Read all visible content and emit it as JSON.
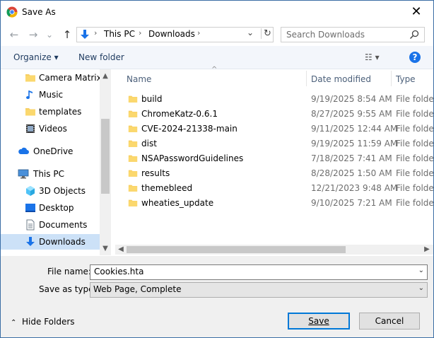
{
  "window": {
    "title": "Save As",
    "close_glyph": "✕"
  },
  "nav": {
    "back_glyph": "←",
    "forward_glyph": "→",
    "recent_glyph": "⌄",
    "up_glyph": "↑",
    "breadcrumbs": [
      "This PC",
      "Downloads"
    ],
    "breadcrumb_sep": "›",
    "dropdown_glyph": "⌄",
    "refresh_glyph": "↻",
    "search_placeholder": "Search Downloads"
  },
  "toolbar": {
    "organize_label": "Organize ▾",
    "new_folder_label": "New folder",
    "view_glyph": "☷ ▾",
    "help_glyph": "?"
  },
  "sidebar": {
    "items": [
      {
        "label": "Camera Matrix",
        "icon": "folder-icon"
      },
      {
        "label": "Music",
        "icon": "music-icon"
      },
      {
        "label": "templates",
        "icon": "folder-icon"
      },
      {
        "label": "Videos",
        "icon": "film-icon"
      },
      {
        "label": "OneDrive",
        "icon": "cloud-icon"
      },
      {
        "label": "This PC",
        "icon": "computer-icon"
      },
      {
        "label": "3D Objects",
        "icon": "cube-icon"
      },
      {
        "label": "Desktop",
        "icon": "desktop-icon"
      },
      {
        "label": "Documents",
        "icon": "document-icon"
      },
      {
        "label": "Downloads",
        "icon": "download-icon",
        "selected": true
      }
    ]
  },
  "columns": {
    "name": "Name",
    "date": "Date modified",
    "type": "Type"
  },
  "files": [
    {
      "name": "build",
      "date": "9/19/2025 8:54 AM",
      "type": "File folder"
    },
    {
      "name": "ChromeKatz-0.6.1",
      "date": "8/27/2025 9:55 AM",
      "type": "File folder"
    },
    {
      "name": "CVE-2024-21338-main",
      "date": "9/11/2025 12:44 AM",
      "type": "File folder"
    },
    {
      "name": "dist",
      "date": "9/19/2025 11:59 AM",
      "type": "File folder"
    },
    {
      "name": "NSAPasswordGuidelines",
      "date": "7/18/2025 7:41 AM",
      "type": "File folder"
    },
    {
      "name": "results",
      "date": "8/28/2025 1:50 AM",
      "type": "File folder"
    },
    {
      "name": "themebleed",
      "date": "12/21/2023 9:48 AM",
      "type": "File folder"
    },
    {
      "name": "wheaties_update",
      "date": "9/10/2025 7:21 AM",
      "type": "File folder"
    }
  ],
  "form": {
    "file_name_label": "File name:",
    "file_name_value": "Cookies.hta",
    "save_type_label": "Save as type:",
    "save_type_value": "Web Page, Complete"
  },
  "footer": {
    "hide_folders_label": "Hide Folders",
    "save_label": "Save",
    "cancel_label": "Cancel"
  },
  "colors": {
    "accent": "#0078d7",
    "folder": "#f7cf62",
    "selected_bg": "#cce1f7"
  }
}
